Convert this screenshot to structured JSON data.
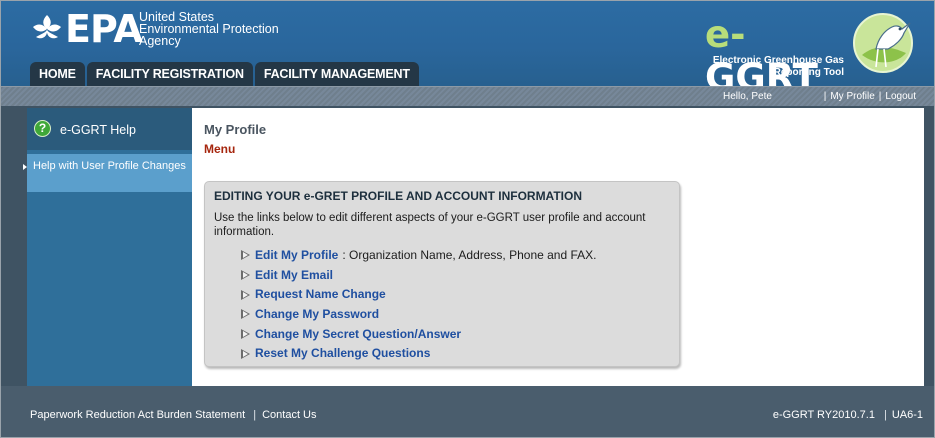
{
  "header": {
    "logo_text": "EPA",
    "agency_lines": [
      "United States",
      "Environmental Protection",
      "Agency"
    ],
    "app_title_prefix": "e-",
    "app_title_main": "GGRT",
    "app_subtitle_1": "Electronic Greenhouse Gas",
    "app_subtitle_2": "Reporting Tool",
    "brand_color": "#2c6ca3",
    "accent_color": "#b8dd7a"
  },
  "nav": {
    "tabs": [
      {
        "label": "HOME"
      },
      {
        "label": "FACILITY REGISTRATION"
      },
      {
        "label": "FACILITY MANAGEMENT"
      }
    ]
  },
  "subbar": {
    "greeting": "Hello, Pete",
    "my_profile": "My Profile",
    "logout": "Logout",
    "separator": "|"
  },
  "sidebar": {
    "help_title": "e-GGRT Help",
    "help_icon": "question-circle-icon",
    "items": [
      {
        "label": "Help with User Profile Changes"
      }
    ]
  },
  "main": {
    "page_title": "My Profile",
    "menu_label": "Menu",
    "panel": {
      "heading": "EDITING YOUR e-GRET PROFILE AND ACCOUNT INFORMATION",
      "description": "Use the links below to edit different aspects of your e-GGRT user profile and account information.",
      "links": [
        {
          "label": "Edit My Profile",
          "desc": ": Organization Name, Address, Phone and FAX."
        },
        {
          "label": "Edit My Email",
          "desc": ""
        },
        {
          "label": "Request Name Change",
          "desc": ""
        },
        {
          "label": "Change My Password",
          "desc": ""
        },
        {
          "label": "Change My Secret Question/Answer",
          "desc": ""
        },
        {
          "label": "Reset My Challenge Questions",
          "desc": ""
        }
      ]
    }
  },
  "footer": {
    "burden_statement": "Paperwork Reduction Act Burden Statement",
    "contact_us": "Contact Us",
    "version": "e-GGRT RY2010.7.1",
    "screen_id": "UA6-1",
    "separator": "|"
  }
}
